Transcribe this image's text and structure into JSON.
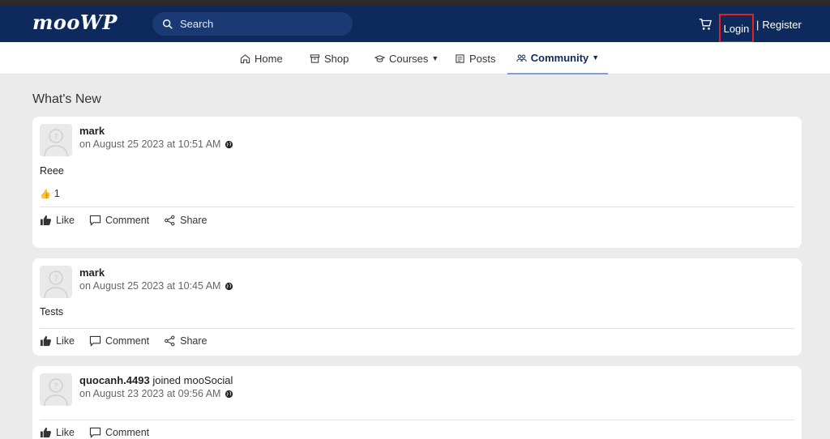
{
  "header": {
    "logo": "mooWP",
    "search_placeholder": "Search",
    "login": "Login",
    "separator": "|",
    "register": "Register"
  },
  "nav": {
    "home": "Home",
    "shop": "Shop",
    "courses": "Courses",
    "posts": "Posts",
    "community": "Community"
  },
  "section_title": "What's New",
  "feed": [
    {
      "author": "mark",
      "time": "on August 25 2023 at 10:51 AM",
      "text": "Reee",
      "reactions": "1"
    },
    {
      "author": "mark",
      "time": "on August 25 2023 at 10:45 AM",
      "text": "Tests"
    },
    {
      "author": "quocanh.4493",
      "activity": "joined mooSocial",
      "time": "on August 23 2023 at 09:56 AM"
    }
  ],
  "actions": {
    "like": "Like",
    "comment": "Comment",
    "share": "Share"
  },
  "colors": {
    "header": "#0e2a5c",
    "search": "#1b3a73",
    "highlight": "#e22222",
    "background": "#ebebeb"
  }
}
